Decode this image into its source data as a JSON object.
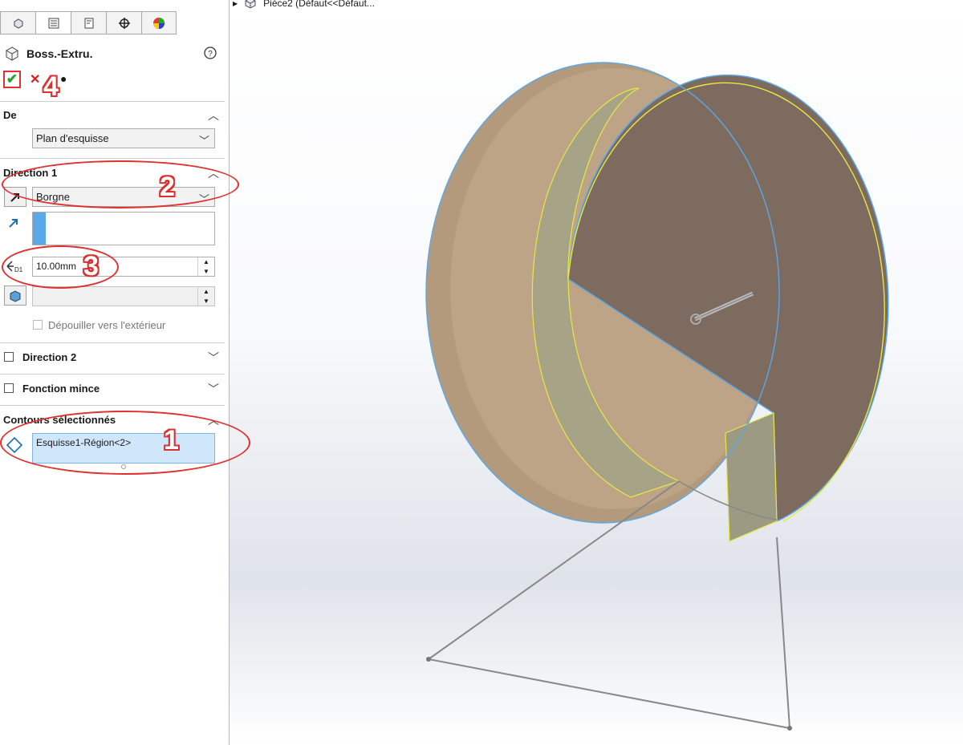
{
  "tree": {
    "node_label": "Pièce2  (Défaut<<Défaut..."
  },
  "feature": {
    "title": "Boss.-Extru."
  },
  "sections": {
    "de": {
      "title": "De",
      "start_condition": "Plan d'esquisse"
    },
    "direction1": {
      "title": "Direction 1",
      "end_condition": "Borgne",
      "depth_value": "10.00mm",
      "draft_label": "Dépouiller vers l'extérieur"
    },
    "direction2": {
      "title": "Direction 2"
    },
    "thin": {
      "title": "Fonction mince"
    },
    "contours": {
      "title": "Contours sélectionnés",
      "items": [
        "Esquisse1-Région<2>"
      ]
    }
  },
  "annotations": {
    "callout1": "1",
    "callout2": "2",
    "callout3": "3",
    "callout4": "4"
  },
  "colors": {
    "face": "#7e6b60",
    "rim": "#b4987a",
    "selection_yellow": "#e8e840",
    "selection_blue": "#5aa8e8",
    "callout_red": "#e0302f",
    "preview_yellow": "#b4ae82"
  }
}
